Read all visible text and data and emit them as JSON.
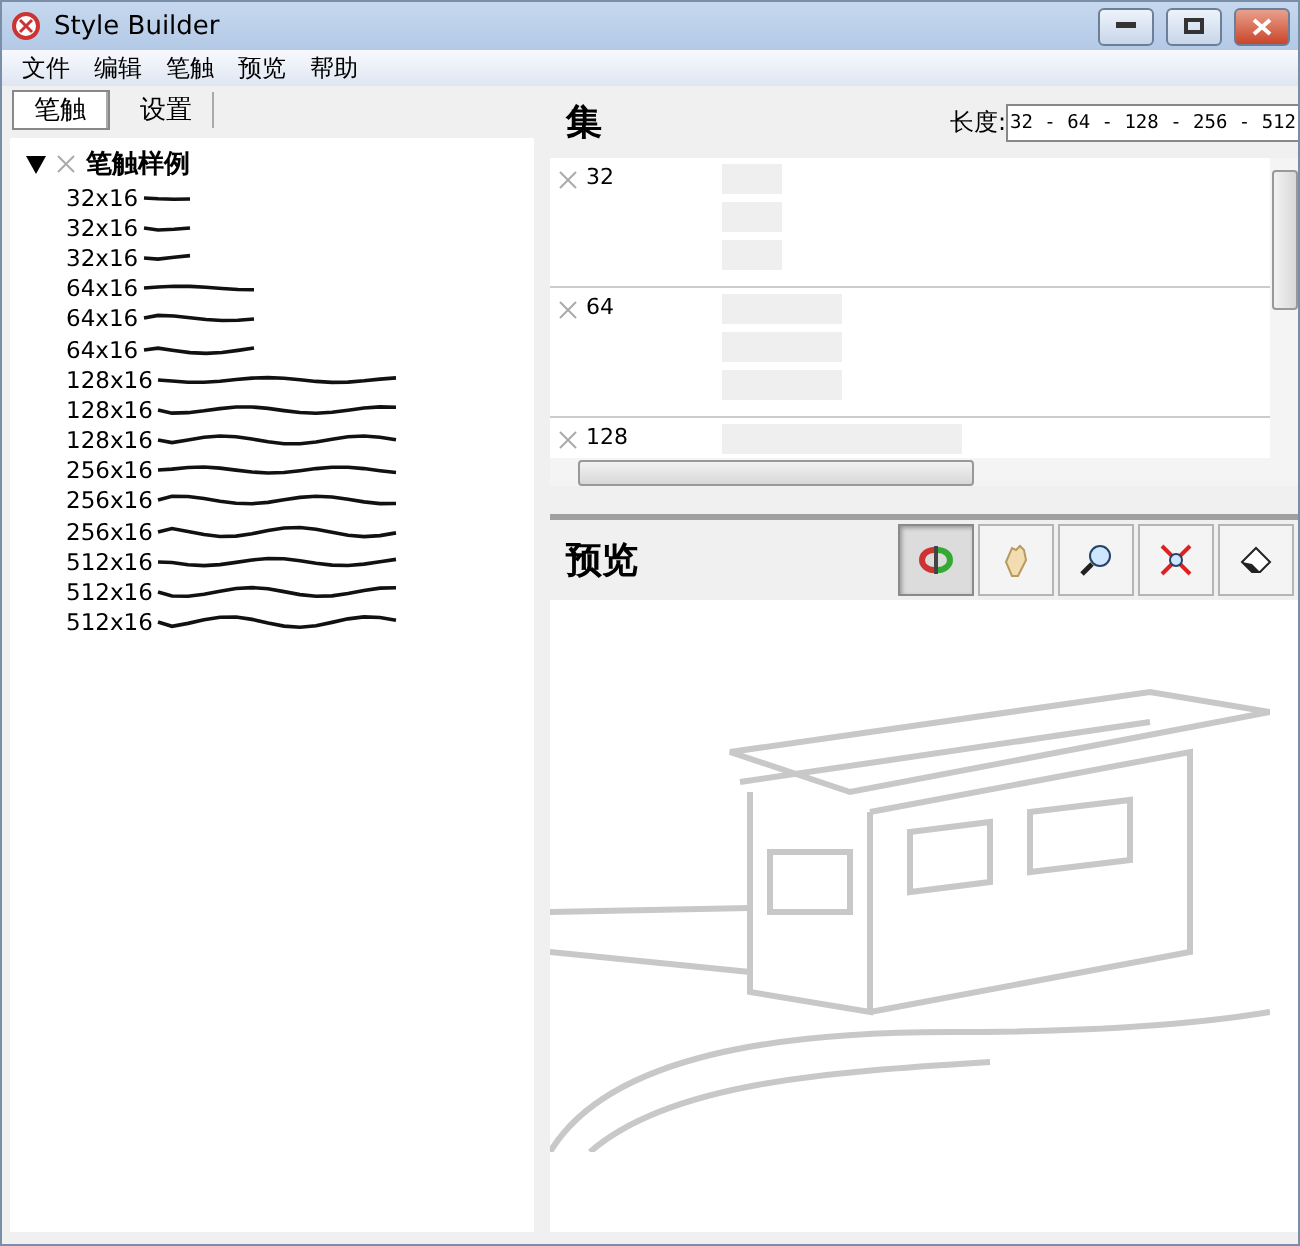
{
  "window": {
    "title": "Style Builder"
  },
  "menu": [
    "文件",
    "编辑",
    "笔触",
    "预览",
    "帮助"
  ],
  "tabs": [
    {
      "label": "笔触",
      "selected": true
    },
    {
      "label": "设置",
      "selected": false
    }
  ],
  "tree": {
    "label": "笔触样例",
    "expanded": true,
    "children": [
      {
        "label": "32x16"
      },
      {
        "label": "32x16"
      },
      {
        "label": "32x16"
      },
      {
        "label": "64x16"
      },
      {
        "label": "64x16"
      },
      {
        "label": "64x16"
      },
      {
        "label": "128x16"
      },
      {
        "label": "128x16"
      },
      {
        "label": "128x16"
      },
      {
        "label": "256x16"
      },
      {
        "label": "256x16"
      },
      {
        "label": "256x16"
      },
      {
        "label": "512x16"
      },
      {
        "label": "512x16"
      },
      {
        "label": "512x16"
      }
    ]
  },
  "sets": {
    "title": "集",
    "length_label": "长度:",
    "length_value": "32 - 64 - 128 - 256 - 512",
    "groups": [
      {
        "label": "32"
      },
      {
        "label": "64"
      },
      {
        "label": "128"
      }
    ]
  },
  "preview": {
    "title": "预览",
    "tools": [
      {
        "kind": "orbit",
        "selected": true
      },
      {
        "kind": "pan",
        "selected": false
      },
      {
        "kind": "zoom",
        "selected": false
      },
      {
        "kind": "extents",
        "selected": false
      },
      {
        "kind": "eraser",
        "selected": false
      }
    ]
  }
}
